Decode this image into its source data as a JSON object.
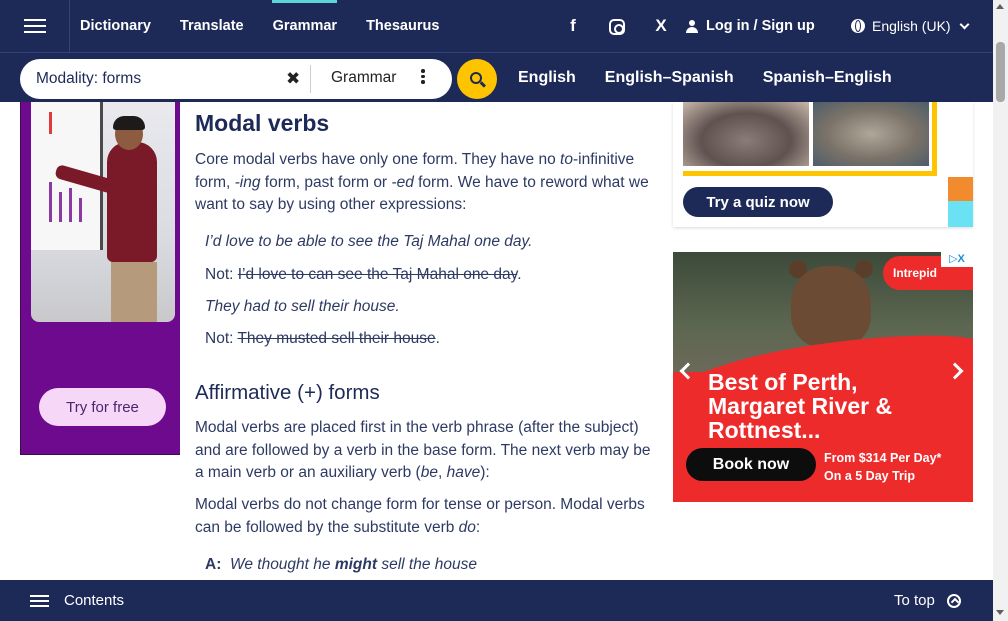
{
  "nav": {
    "links": [
      "Dictionary",
      "Translate",
      "Grammar",
      "Thesaurus"
    ],
    "active": "Grammar",
    "social_icons": [
      "facebook-icon",
      "instagram-icon",
      "x-icon"
    ],
    "login": "Log in / Sign up",
    "language": "English (UK)"
  },
  "search": {
    "value": "Modality: forms",
    "dictionary": "Grammar",
    "dict_links": [
      "English",
      "English–Spanish",
      "Spanish–English"
    ]
  },
  "left_ad": {
    "cta": "Try for free"
  },
  "article": {
    "title": "Modal verbs",
    "intro_parts": [
      "Core modal verbs have only one form. They have no ",
      "to",
      "-infinitive form, ",
      "-ing",
      " form, past form or ",
      "-ed",
      " form. We have to reword what we want to say by using other expressions:"
    ],
    "examples": [
      {
        "prefix": "",
        "text": "I’d love to be able to see the Taj Mahal one day.",
        "style": "italic"
      },
      {
        "prefix": "Not: ",
        "text": "I’d love to can see the Taj Mahal one day",
        "style": "strike",
        "suffix": "."
      },
      {
        "prefix": "",
        "text": "They had to sell their house.",
        "style": "italic"
      },
      {
        "prefix": "Not: ",
        "text": "They musted sell their house",
        "style": "strike",
        "suffix": "."
      }
    ],
    "section_title": "Affirmative (+) forms",
    "para2_parts": [
      "Modal verbs are placed first in the verb phrase (after the subject) and are followed by a verb in the base form. The next verb may be a main verb or an auxiliary verb (",
      "be",
      ", ",
      "have",
      "):"
    ],
    "para3_parts": [
      "Modal verbs do not change form for tense or person. Modal verbs can be followed by the substitute verb ",
      "do",
      ":"
    ],
    "dialogue": {
      "speaker": "A:",
      "before": "We thought he ",
      "bold": "might",
      "after": " sell the house"
    }
  },
  "quiz": {
    "button": "Try a quiz now"
  },
  "right_ad": {
    "choices": "▷X",
    "brand": "Intrepid",
    "headline": "Best of Perth, Margaret River & Rottnest...",
    "cta": "Book now",
    "price_line1": "From $314 Per Day*",
    "price_line2": "On a 5 Day Trip"
  },
  "bottom": {
    "contents": "Contents",
    "to_top": "To top"
  }
}
